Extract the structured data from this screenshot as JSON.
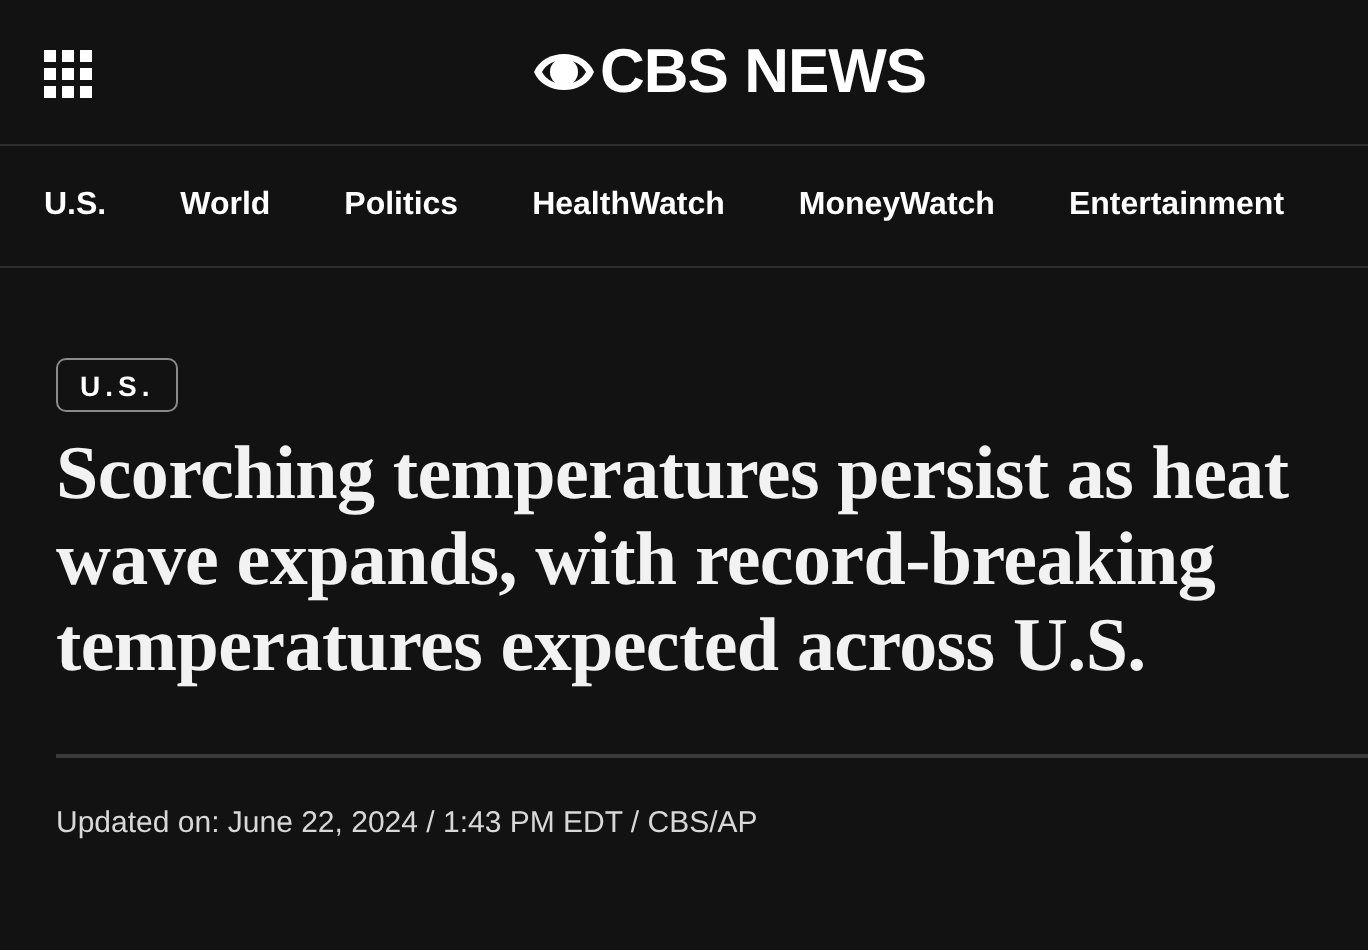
{
  "header": {
    "logo_text": "CBS NEWS"
  },
  "nav": [
    {
      "label": "U.S."
    },
    {
      "label": "World"
    },
    {
      "label": "Politics"
    },
    {
      "label": "HealthWatch"
    },
    {
      "label": "MoneyWatch"
    },
    {
      "label": "Entertainment"
    }
  ],
  "article": {
    "tag": "U.S.",
    "headline": "Scorching temperatures persist as heat wave expands, with record-breaking temperatures expected across U.S.",
    "byline": "Updated on: June 22, 2024 / 1:43 PM EDT / CBS/AP"
  }
}
